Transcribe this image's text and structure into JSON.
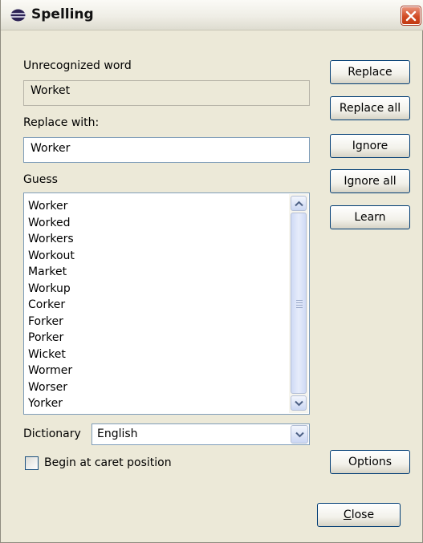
{
  "window": {
    "title": "Spelling",
    "app_icon": "eclipse-icon",
    "close_icon": "close-icon"
  },
  "unrecognized": {
    "label": "Unrecognized word",
    "value": "Worket"
  },
  "replace_with": {
    "label": "Replace with:",
    "value": "Worker"
  },
  "guess": {
    "label": "Guess",
    "items": [
      "Worker",
      "Worked",
      "Workers",
      "Workout",
      "Market",
      "Workup",
      "Corker",
      "Forker",
      "Porker",
      "Wicket",
      "Wormer",
      "Worser",
      "Yorker"
    ]
  },
  "dictionary": {
    "label": "Dictionary",
    "selected": "English"
  },
  "begin_at_caret": {
    "label": "Begin at caret position",
    "checked": false
  },
  "buttons": {
    "replace": "Replace",
    "replace_all": "Replace all",
    "ignore": "Ignore",
    "ignore_all": "Ignore all",
    "learn": "Learn",
    "options": "Options",
    "close_mnemonic": "C",
    "close_rest": "lose"
  },
  "colors": {
    "window_bg": "#ece9d8",
    "field_border": "#7f9db9",
    "button_border": "#003c74",
    "close_red": "#d24b25"
  }
}
